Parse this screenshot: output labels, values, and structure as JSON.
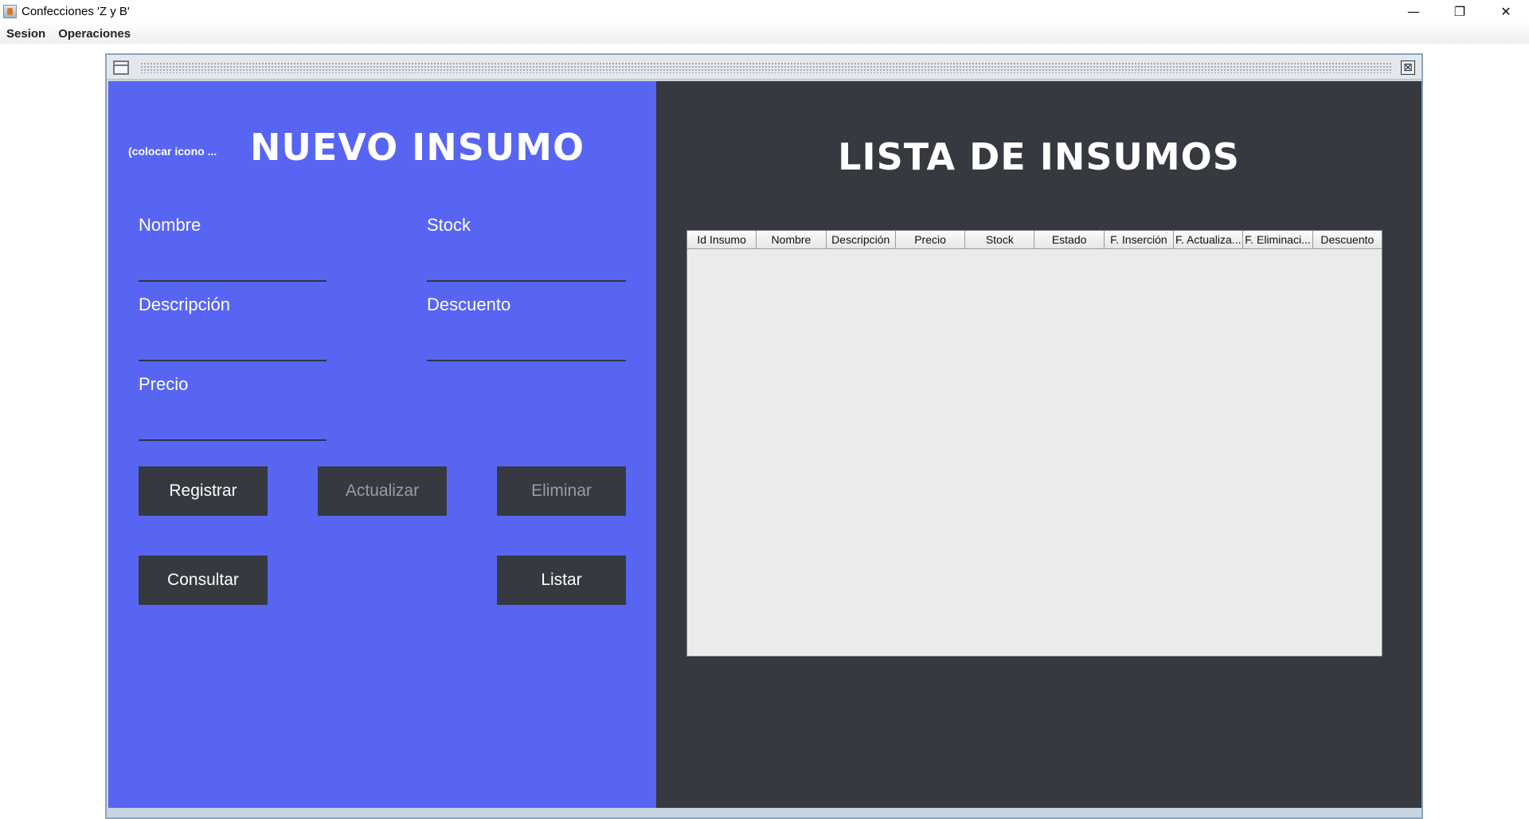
{
  "window": {
    "title": "Confecciones 'Z y B'",
    "controls": {
      "minimize": "—",
      "restore": "❐",
      "close": "✕"
    }
  },
  "menubar": {
    "items": [
      "Sesion",
      "Operaciones"
    ]
  },
  "frame": {
    "close_glyph": "⊠"
  },
  "left_panel": {
    "icon_placeholder": "(colocar icono ...",
    "title": "NUEVO INSUMO",
    "fields": {
      "nombre": {
        "label": "Nombre",
        "value": ""
      },
      "stock": {
        "label": "Stock",
        "value": ""
      },
      "descripcion": {
        "label": "Descripción",
        "value": ""
      },
      "descuento": {
        "label": "Descuento",
        "value": ""
      },
      "precio": {
        "label": "Precio",
        "value": ""
      }
    },
    "buttons": {
      "registrar": "Registrar",
      "actualizar": "Actualizar",
      "eliminar": "Eliminar",
      "consultar": "Consultar",
      "listar": "Listar"
    }
  },
  "right_panel": {
    "title": "LISTA DE INSUMOS",
    "table": {
      "columns": [
        "Id Insumo",
        "Nombre",
        "Descripción",
        "Precio",
        "Stock",
        "Estado",
        "F. Inserción",
        "F. Actualiza...",
        "F. Eliminaci...",
        "Descuento"
      ],
      "rows": []
    }
  },
  "colors": {
    "left_panel_bg": "#5865f2",
    "right_panel_bg": "#36393f",
    "button_bg": "#36393f"
  }
}
